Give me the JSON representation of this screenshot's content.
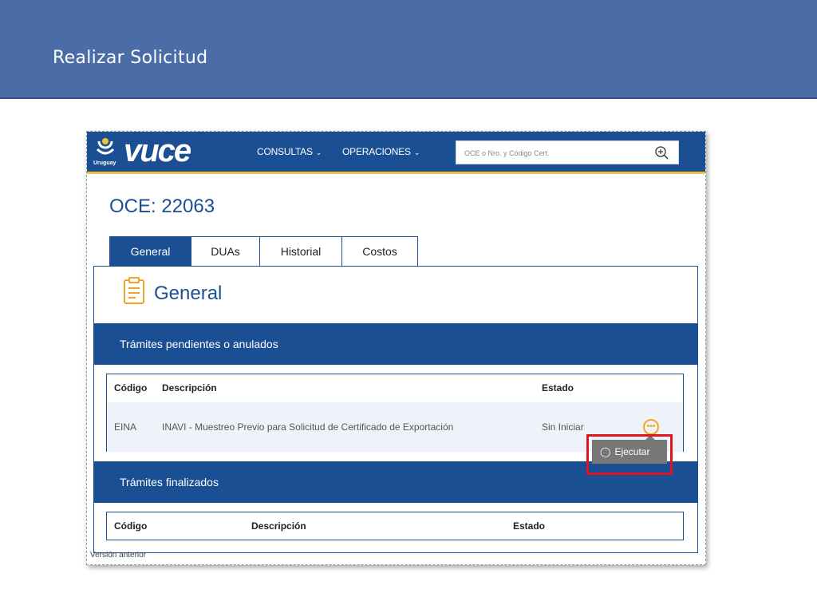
{
  "slide": {
    "title": "Realizar Solicitud"
  },
  "colors": {
    "header_band": "#4a6da8",
    "brand_blue": "#1b4f94",
    "accent_yellow": "#f3c137",
    "highlight_red": "#e0141e",
    "action_orange": "#f0a429"
  },
  "navbar": {
    "logo_word": "vuce",
    "logo_country": "Uruguay",
    "logo_icon": "sun-emblem-icon",
    "menu": [
      {
        "label": "CONSULTAS",
        "icon": "chevron-down-icon"
      },
      {
        "label": "OPERACIONES",
        "icon": "chevron-down-icon"
      }
    ],
    "search": {
      "placeholder": "OCE o Nro. y Código Cert.",
      "value": "",
      "icon": "zoom-in-icon"
    }
  },
  "page": {
    "title": "OCE: 22063"
  },
  "tabs": [
    {
      "label": "General",
      "active": true
    },
    {
      "label": "DUAs",
      "active": false
    },
    {
      "label": "Historial",
      "active": false
    },
    {
      "label": "Costos",
      "active": false
    }
  ],
  "section": {
    "title": "General",
    "icon": "clipboard-icon"
  },
  "pending": {
    "heading": "Trámites pendientes o anulados",
    "columns": [
      "Código",
      "Descripción",
      "Estado"
    ],
    "rows": [
      {
        "codigo": "EINA",
        "descripcion": "INAVI - Muestreo Previo para Solicitud de Certificado de Exportación",
        "estado": "Sin Iniciar",
        "action_icon": "more-options-icon"
      }
    ],
    "action_menu": {
      "label": "Ejecutar",
      "icon": "check-circle-icon"
    }
  },
  "finalized": {
    "heading": "Trámites finalizados",
    "columns": [
      "Código",
      "Descripción",
      "Estado"
    ]
  },
  "footer": {
    "version_link": "Versión anterior"
  }
}
